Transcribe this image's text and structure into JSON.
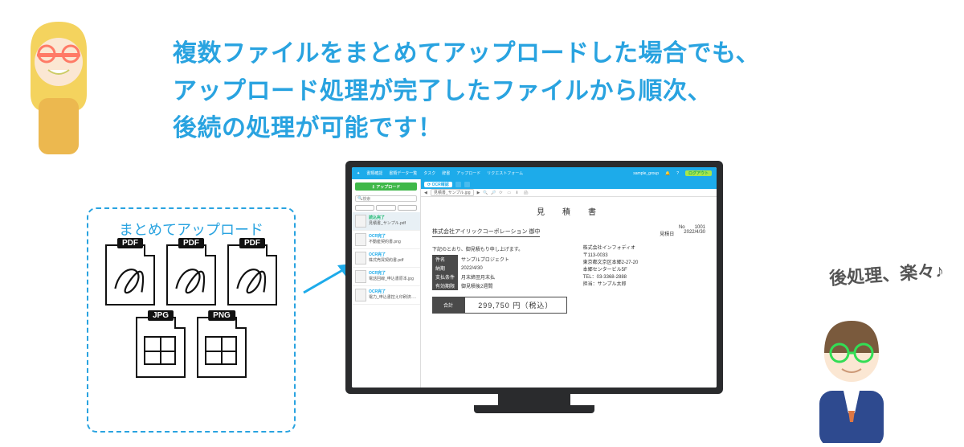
{
  "headline": {
    "line1": "複数ファイルをまとめてアップロードした場合でも、",
    "line2": "アップロード処理が完了したファイルから順次、",
    "line3": "後続の処理が可能です！"
  },
  "upload_box": {
    "title": "まとめてアップロード",
    "files": [
      {
        "type": "PDF"
      },
      {
        "type": "PDF"
      },
      {
        "type": "PDF"
      },
      {
        "type": "JPG"
      },
      {
        "type": "PNG"
      }
    ]
  },
  "speech": "後処理、楽々♪",
  "app": {
    "topnav": [
      "書類確認",
      "書類データ一覧",
      "タスク",
      "辞書",
      "アップロード",
      "リクエストフォーム"
    ],
    "user": "sample_group",
    "logout": "ログアウト",
    "upload_button": "↥ アップロード",
    "search_placeholder": "検索",
    "ocr_chip": "⟳ OCR確認",
    "crumb_file": "見積書_サンプル.jpg",
    "sidebar": [
      {
        "status": "読込完了",
        "status_kind": "green",
        "name": "見積書_サンプル.pdf",
        "selected": true
      },
      {
        "status": "OCR完了",
        "status_kind": "blue",
        "name": "不動産契約書.png",
        "selected": false
      },
      {
        "status": "OCR完了",
        "status_kind": "blue",
        "name": "株式売買契約書.pdf",
        "selected": false
      },
      {
        "status": "OCR完了",
        "status_kind": "blue",
        "name": "電話回線_申込書原本.jpg",
        "selected": false
      },
      {
        "status": "OCR完了",
        "status_kind": "blue",
        "name": "電力_申込書控え印刷済.pdf",
        "selected": false
      }
    ]
  },
  "document": {
    "title": "見　積　書",
    "recipient": "株式会社アイリックコーポレーション 御中",
    "meta": {
      "no_label": "No",
      "no": "1001",
      "date_label": "見積日",
      "date": "2022/4/30"
    },
    "lead": "下記のとおり、御見積もり申し上げます。",
    "rows": [
      {
        "k": "件名",
        "v": "サンプルプロジェクト"
      },
      {
        "k": "納期",
        "v": "2022/4/30"
      },
      {
        "k": "支払条件",
        "v": "月末締翌月末払"
      },
      {
        "k": "有効期限",
        "v": "御見積後2週間"
      }
    ],
    "total_label": "合計",
    "total_value": "299,750 円（税込）",
    "company": {
      "name": "株式会社インフォディオ",
      "zip": "〒113-0033",
      "addr": "東京都文京区本郷2-27-20",
      "bldg": "本郷センタービル5F",
      "tel": "TEL：03-3368-2888",
      "contact": "担当：サンプル太郎"
    }
  }
}
